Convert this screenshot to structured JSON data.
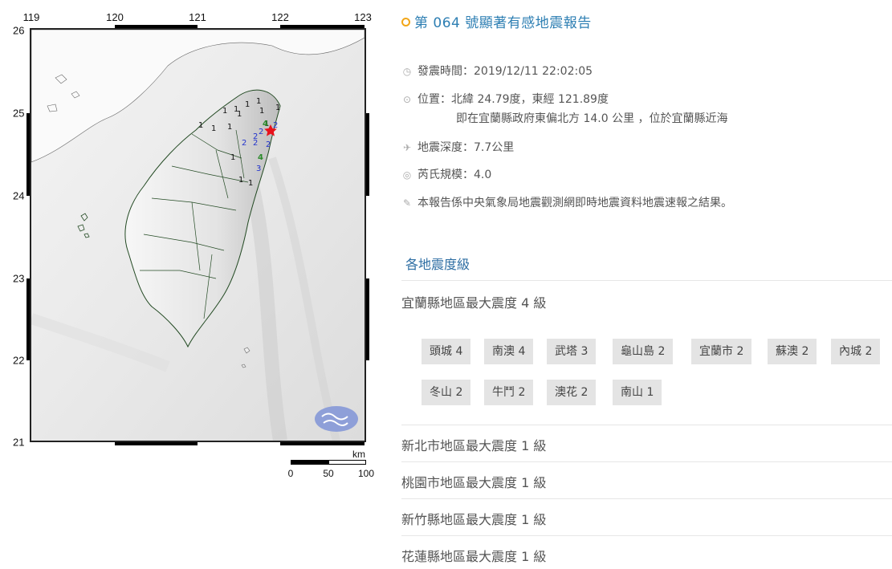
{
  "map": {
    "top_ticks": [
      "119",
      "120",
      "121",
      "122",
      "123"
    ],
    "left_ticks": [
      "26",
      "25",
      "24",
      "23",
      "22",
      "21"
    ],
    "intensity_marks": [
      {
        "town": "頭城",
        "value": "4"
      },
      {
        "town": "南澳",
        "value": "4"
      },
      {
        "town": "武塔",
        "value": "3"
      },
      {
        "town": "龜山島",
        "value": "2"
      },
      {
        "town": "宜蘭市",
        "value": "2"
      },
      {
        "town": "蘇澳",
        "value": "2"
      },
      {
        "town": "內城",
        "value": "2"
      },
      {
        "town": "冬山",
        "value": "2"
      },
      {
        "town": "牛鬥",
        "value": "2"
      },
      {
        "town": "澳花",
        "value": "2"
      },
      {
        "town": "南山",
        "value": "1"
      }
    ],
    "scale": {
      "unit": "km",
      "labels": [
        "0",
        "50",
        "100"
      ]
    }
  },
  "report": {
    "title": "第 064 號顯著有感地震報告",
    "origin_time": "發震時間：2019/12/11 22:02:05",
    "location": "位置：北緯 24.79度，東經 121.89度",
    "location_detail": "即在宜蘭縣政府東偏北方 14.0 公里 ，位於宜蘭縣近海",
    "depth": "地震深度：7.7公里",
    "magnitude": "芮氏規模：4.0",
    "note": "本報告係中央氣象局地震觀測網即時地震資料地震速報之結果。",
    "icons": {
      "origin_time": "clock-icon",
      "location": "map-pin-icon",
      "depth": "airplane-icon",
      "magnitude": "wifi-signal-icon",
      "note": "pencil-icon"
    },
    "colors": {
      "title": "#2e7fb3",
      "title_dot": "#f2a618",
      "section": "#2e6ea3",
      "chip_bg": "#e4e4e4"
    }
  },
  "intensity": {
    "section_title": "各地震度級",
    "regions": [
      {
        "name": "宜蘭縣地區最大震度 4 級",
        "stations": [
          "頭城 4",
          "南澳 4",
          "武塔 3",
          "龜山島 2",
          "宜蘭市 2",
          "蘇澳 2",
          "內城 2",
          "冬山 2",
          "牛鬥 2",
          "澳花 2",
          "南山 1"
        ]
      },
      {
        "name": "新北市地區最大震度 1 級",
        "stations": []
      },
      {
        "name": "桃園市地區最大震度 1 級",
        "stations": []
      },
      {
        "name": "新竹縣地區最大震度 1 級",
        "stations": []
      },
      {
        "name": "花蓮縣地區最大震度 1 級",
        "stations": []
      }
    ]
  }
}
